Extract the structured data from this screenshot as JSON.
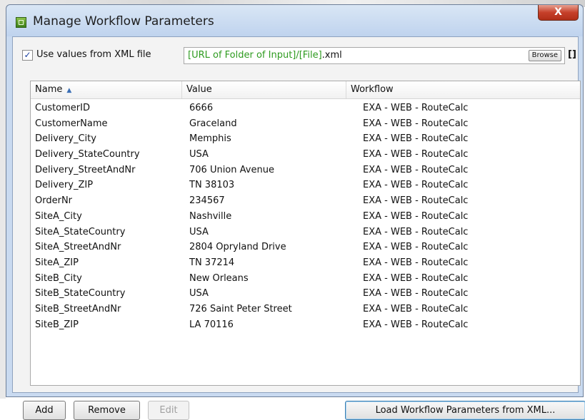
{
  "window": {
    "title": "Manage Workflow Parameters",
    "close_label": "X"
  },
  "xml_source": {
    "checked": true,
    "checkbox_glyph": "✓",
    "label": "Use values from XML file",
    "path_variable": "[URL of Folder of Input]/[File]",
    "path_suffix": ".xml",
    "browse_label": "Browse",
    "extra_button_label": "[]"
  },
  "table": {
    "columns": [
      "Name",
      "Value",
      "Workflow"
    ],
    "sort_icon": "▲",
    "rows": [
      {
        "name": "CustomerID",
        "value": "6666",
        "workflow": "EXA - WEB - RouteCalc"
      },
      {
        "name": "CustomerName",
        "value": "Graceland",
        "workflow": "EXA - WEB - RouteCalc"
      },
      {
        "name": "Delivery_City",
        "value": "Memphis",
        "workflow": "EXA - WEB - RouteCalc"
      },
      {
        "name": "Delivery_StateCountry",
        "value": "USA",
        "workflow": "EXA - WEB - RouteCalc"
      },
      {
        "name": "Delivery_StreetAndNr",
        "value": "706 Union Avenue",
        "workflow": "EXA - WEB - RouteCalc"
      },
      {
        "name": "Delivery_ZIP",
        "value": "TN 38103",
        "workflow": "EXA - WEB - RouteCalc"
      },
      {
        "name": "OrderNr",
        "value": "234567",
        "workflow": "EXA - WEB - RouteCalc"
      },
      {
        "name": "SiteA_City",
        "value": "Nashville",
        "workflow": "EXA - WEB - RouteCalc"
      },
      {
        "name": "SiteA_StateCountry",
        "value": "USA",
        "workflow": "EXA - WEB - RouteCalc"
      },
      {
        "name": "SiteA_StreetAndNr",
        "value": "2804 Opryland Drive",
        "workflow": "EXA - WEB - RouteCalc"
      },
      {
        "name": "SiteA_ZIP",
        "value": "TN 37214",
        "workflow": "EXA - WEB - RouteCalc"
      },
      {
        "name": "SiteB_City",
        "value": "New Orleans",
        "workflow": "EXA - WEB - RouteCalc"
      },
      {
        "name": "SiteB_StateCountry",
        "value": "USA",
        "workflow": "EXA - WEB - RouteCalc"
      },
      {
        "name": "SiteB_StreetAndNr",
        "value": "726 Saint Peter Street",
        "workflow": "EXA - WEB - RouteCalc"
      },
      {
        "name": "SiteB_ZIP",
        "value": "LA 70116",
        "workflow": "EXA - WEB - RouteCalc"
      }
    ]
  },
  "buttons": {
    "add": "Add",
    "remove": "Remove",
    "edit": "Edit",
    "load": "Load Workflow Parameters from XML..."
  },
  "icons": {
    "app": "workflow-app-icon",
    "close": "close-icon",
    "sort": "sort-ascending-icon"
  },
  "colors": {
    "variable_text": "#2e9b1f",
    "close_button": "#c6402a",
    "default_button_border": "#3c7fb1"
  }
}
